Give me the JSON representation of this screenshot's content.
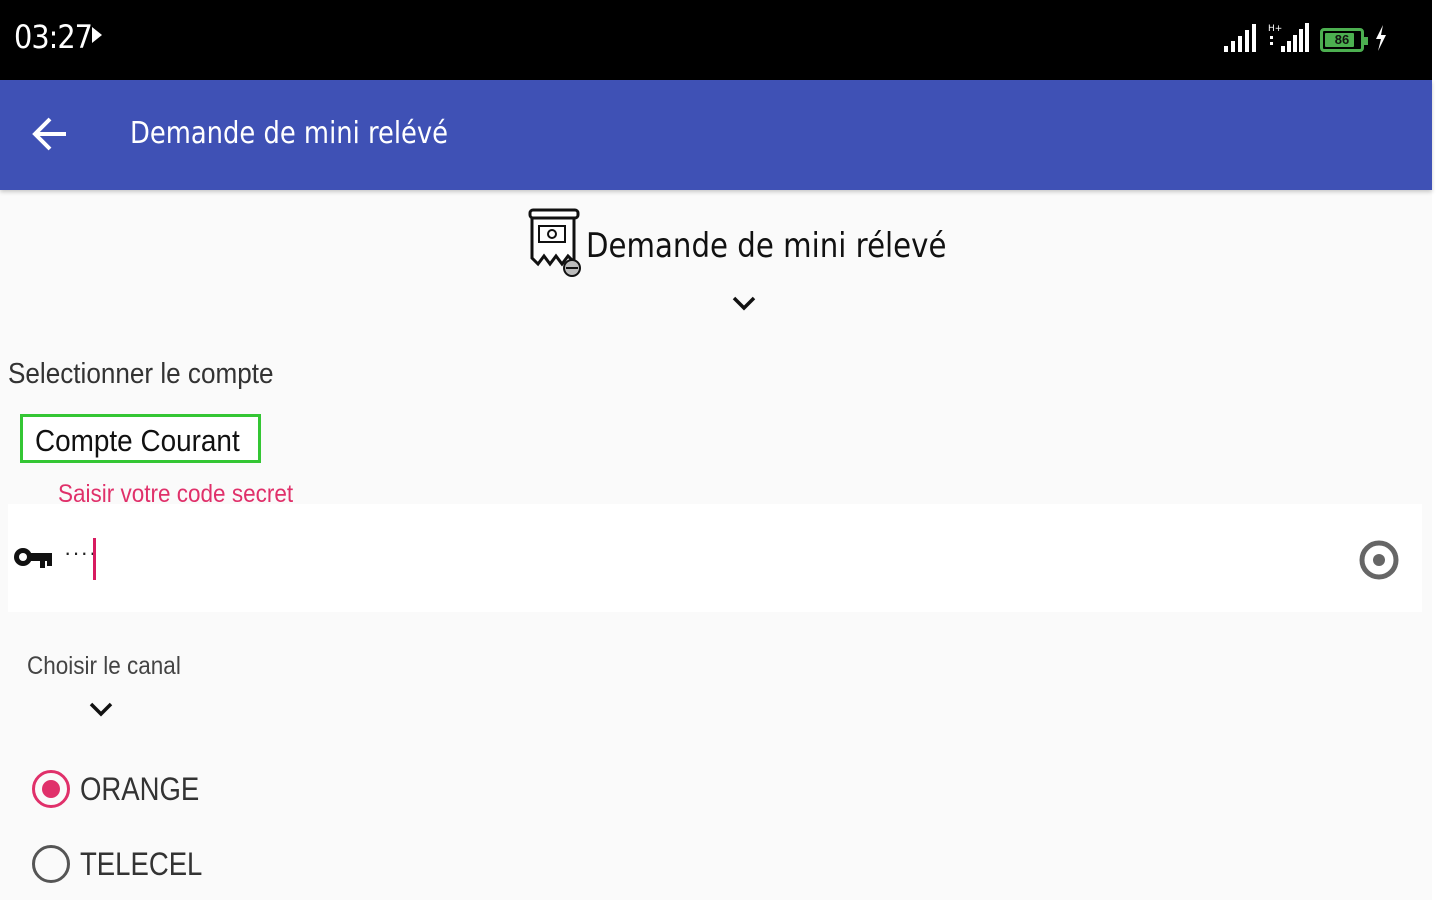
{
  "status_bar": {
    "time": "03:27",
    "battery_level": "86",
    "battery_fraction": 0.86
  },
  "app_bar": {
    "title": "Demande de mini relévé"
  },
  "header": {
    "title": "Demande de mini rélevé"
  },
  "account": {
    "label": "Selectionner le compte",
    "selected": "Compte Courant"
  },
  "secret": {
    "label": "Saisir votre code secret",
    "masked_value": "····"
  },
  "canal": {
    "label": "Choisir le canal",
    "options": [
      {
        "label": "ORANGE",
        "checked": true
      },
      {
        "label": "TELECEL",
        "checked": false
      }
    ]
  },
  "colors": {
    "app_bar": "#3f51b5",
    "accent": "#e0306a",
    "selected_border": "#34c634",
    "status_bar": "#000000"
  },
  "icons": {
    "back": "arrow-left-icon",
    "header": "receipt-icon",
    "key": "key-icon",
    "visibility": "eye-icon",
    "expand": "chevron-down-icon",
    "signal": "signal-icon",
    "battery": "battery-icon",
    "charging": "charging-icon",
    "play": "play-icon"
  }
}
